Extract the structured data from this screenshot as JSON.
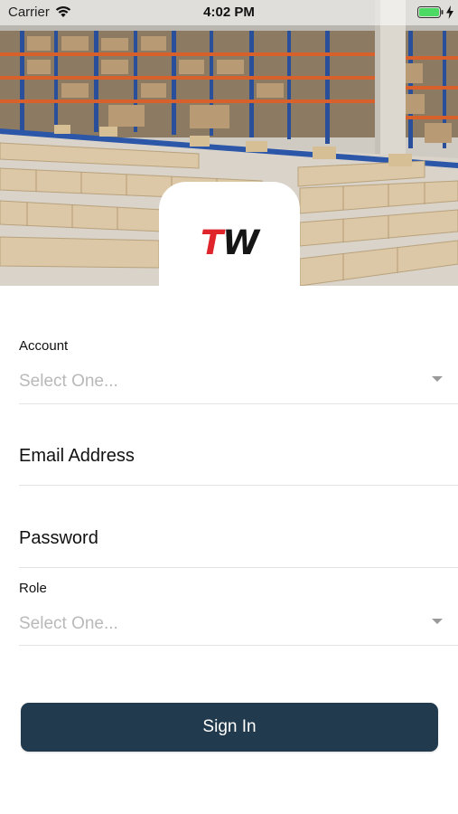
{
  "status_bar": {
    "carrier": "Carrier",
    "time": "4:02 PM"
  },
  "logo": {
    "letter_1": "T",
    "letter_2": "W",
    "letter_1_color": "#e0242b",
    "letter_2_color": "#151515"
  },
  "form": {
    "account": {
      "label": "Account",
      "value": "Select One..."
    },
    "email": {
      "placeholder": "Email Address"
    },
    "password": {
      "placeholder": "Password"
    },
    "role": {
      "label": "Role",
      "value": "Select One..."
    },
    "sign_in_label": "Sign In"
  },
  "colors": {
    "button": "#213a4d",
    "divider": "#e3e3e3",
    "placeholder_grey": "#b9b9b9"
  }
}
